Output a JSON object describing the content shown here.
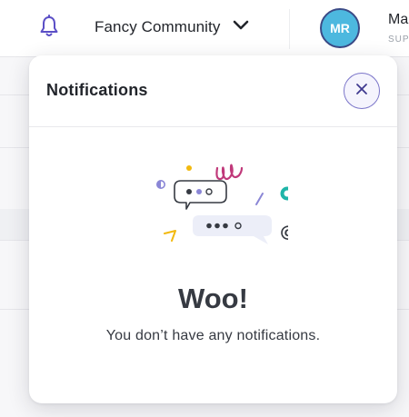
{
  "header": {
    "community_name": "Fancy Community",
    "avatar_initials": "MR",
    "user_name": "Ma",
    "user_role": "SUP"
  },
  "notifications": {
    "title": "Notifications",
    "empty_title": "Woo!",
    "empty_message": "You don’t have any notifications."
  },
  "colors": {
    "accent": "#5b4fc6",
    "avatar_bg": "#4db8df",
    "avatar_border": "#3b4a86",
    "illustration_pink": "#c0397a",
    "illustration_teal": "#1fb5a8",
    "illustration_yellow": "#f2b90f",
    "illustration_lavender": "#8a86d6"
  },
  "icons": {
    "bell": "bell-icon",
    "dropdown": "chevron-down-icon",
    "close": "close-icon"
  }
}
